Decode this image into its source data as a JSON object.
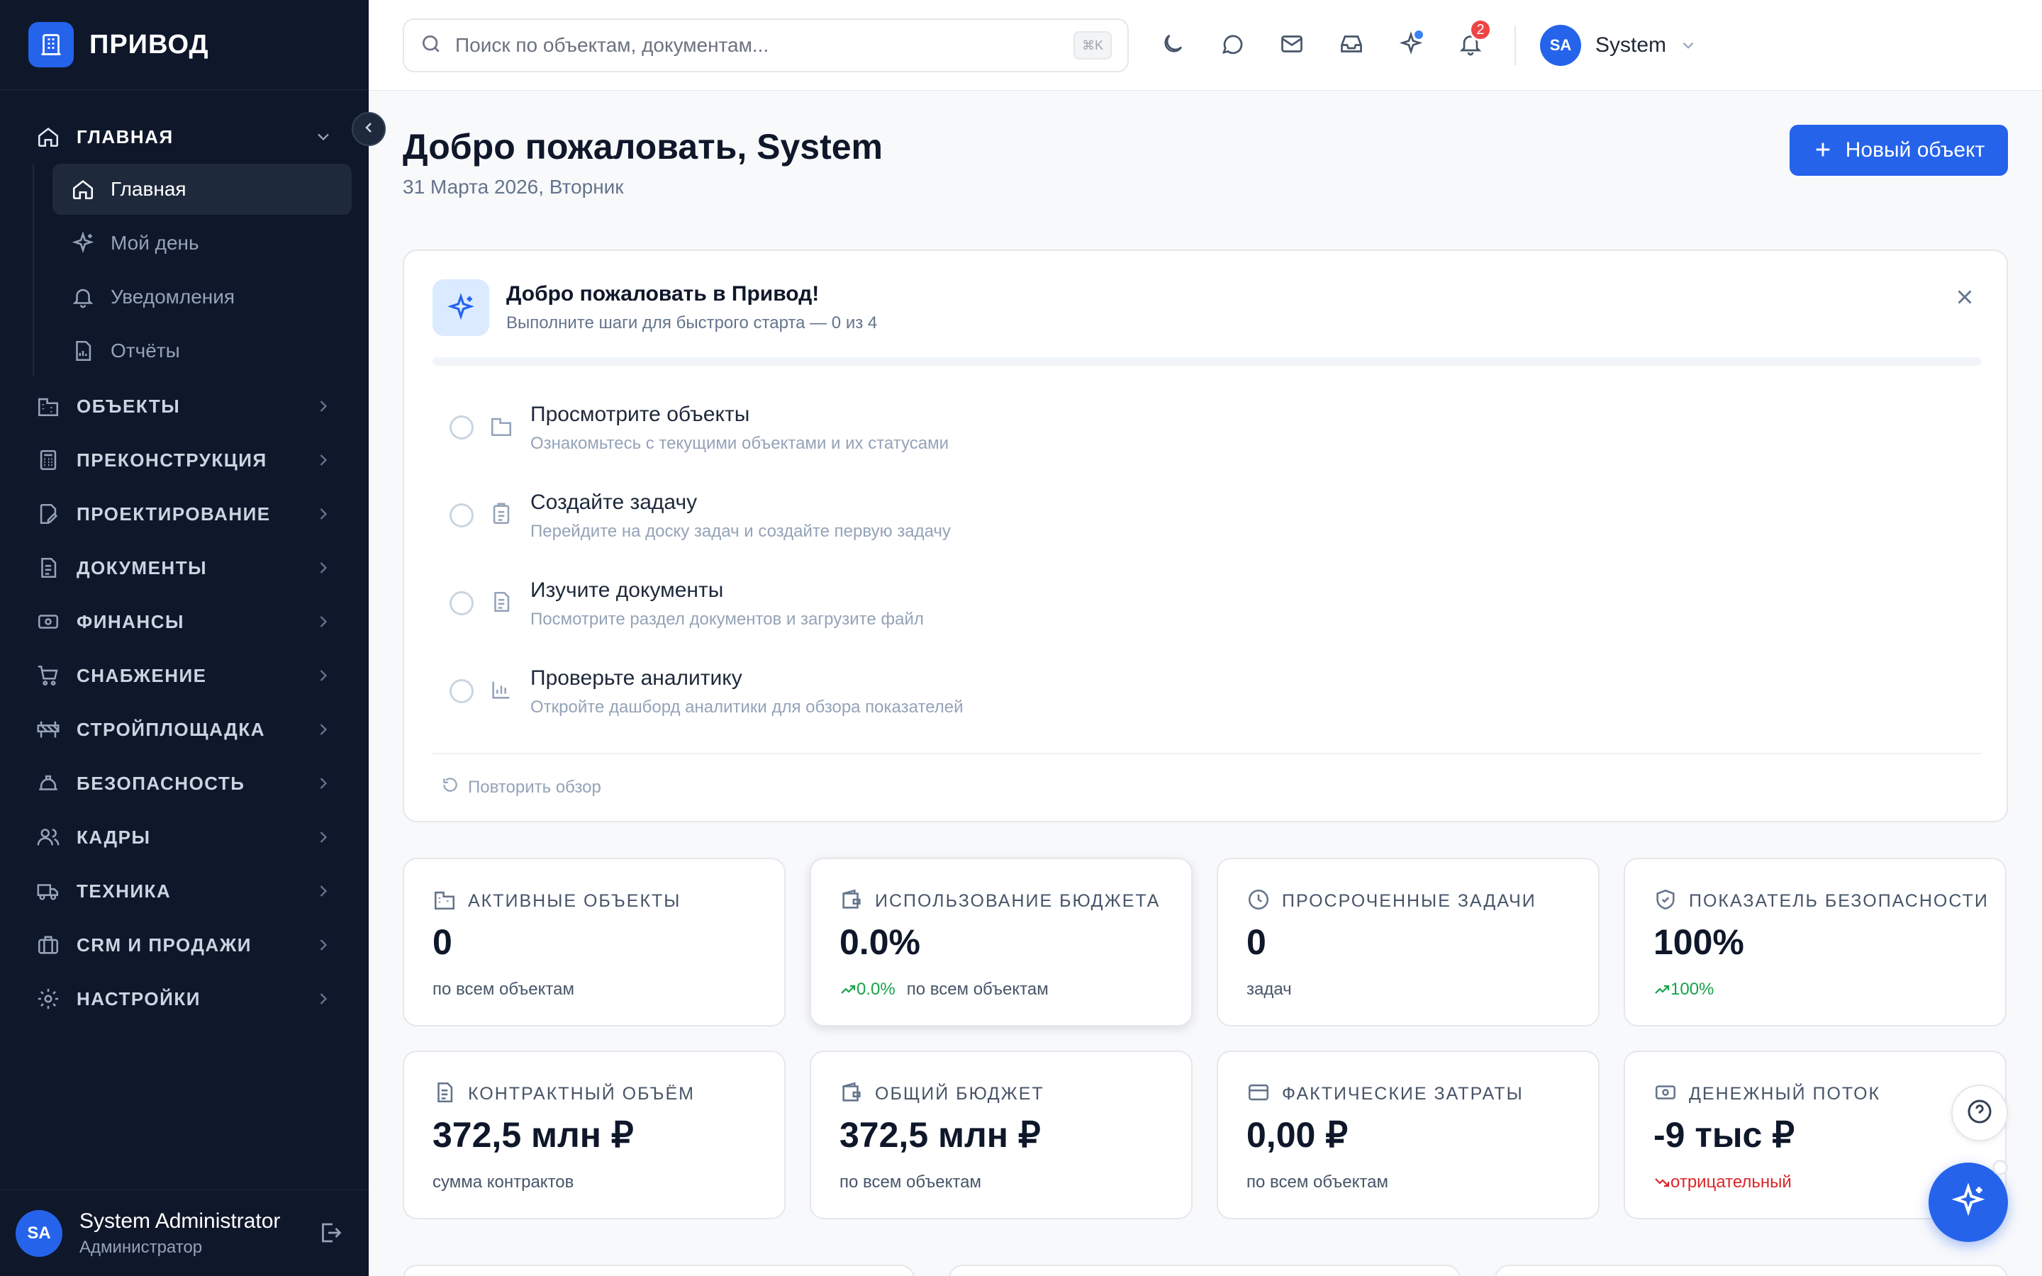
{
  "app": {
    "name": "ПРИВОД"
  },
  "sidebar": {
    "main_section": {
      "label": "ГЛАВНАЯ"
    },
    "sub_items": [
      {
        "label": "Главная",
        "icon": "home-icon",
        "active": true
      },
      {
        "label": "Мой день",
        "icon": "sparkles-icon"
      },
      {
        "label": "Уведомления",
        "icon": "bell-icon"
      },
      {
        "label": "Отчёты",
        "icon": "report-icon"
      }
    ],
    "sections": [
      {
        "label": "ОБЪЕКТЫ",
        "icon": "building-icon"
      },
      {
        "label": "ПРЕКОНСТРУКЦИЯ",
        "icon": "calculator-icon"
      },
      {
        "label": "ПРОЕКТИРОВАНИЕ",
        "icon": "design-icon"
      },
      {
        "label": "ДОКУМЕНТЫ",
        "icon": "document-icon"
      },
      {
        "label": "ФИНАНСЫ",
        "icon": "money-icon"
      },
      {
        "label": "СНАБЖЕНИЕ",
        "icon": "cart-icon"
      },
      {
        "label": "СТРОЙПЛОЩАДКА",
        "icon": "barrier-icon"
      },
      {
        "label": "БЕЗОПАСНОСТЬ",
        "icon": "hardhat-icon"
      },
      {
        "label": "КАДРЫ",
        "icon": "users-icon"
      },
      {
        "label": "ТЕХНИКА",
        "icon": "truck-icon"
      },
      {
        "label": "CRM И ПРОДАЖИ",
        "icon": "briefcase-icon"
      },
      {
        "label": "НАСТРОЙКИ",
        "icon": "gear-icon"
      }
    ],
    "user": {
      "initials": "SA",
      "name": "System Administrator",
      "role": "Администратор"
    }
  },
  "topbar": {
    "search": {
      "placeholder": "Поиск по объектам, документам...",
      "shortcut": "⌘K"
    },
    "notifications_count": "2",
    "user": {
      "initials": "SA",
      "name": "System"
    }
  },
  "page": {
    "title": "Добро пожаловать, System",
    "date": "31 Марта 2026, Вторник",
    "new_button": "Новый объект"
  },
  "welcome": {
    "title": "Добро пожаловать в Привод!",
    "subtitle": "Выполните шаги для быстрого старта — 0 из 4",
    "progress": 0,
    "steps": [
      {
        "title": "Просмотрите объекты",
        "desc": "Ознакомьтесь с текущими объектами и их статусами",
        "icon": "building-icon"
      },
      {
        "title": "Создайте задачу",
        "desc": "Перейдите на доску задач и создайте первую задачу",
        "icon": "clipboard-icon"
      },
      {
        "title": "Изучите документы",
        "desc": "Посмотрите раздел документов и загрузите файл",
        "icon": "document-icon"
      },
      {
        "title": "Проверьте аналитику",
        "desc": "Откройте дашборд аналитики для обзора показателей",
        "icon": "chart-icon"
      }
    ],
    "replay": "Повторить обзор"
  },
  "kpis": [
    {
      "label": "АКТИВНЫЕ ОБЪЕКТЫ",
      "value": "0",
      "trend": "",
      "foot": "по всем объектам",
      "icon": "building-icon"
    },
    {
      "label": "ИСПОЛЬЗОВАНИЕ БЮДЖЕТА",
      "value": "0.0%",
      "trend": "0.0%",
      "foot": "по всем объектам",
      "icon": "wallet-icon"
    },
    {
      "label": "ПРОСРОЧЕННЫЕ ЗАДАЧИ",
      "value": "0",
      "trend": "",
      "foot": "задач",
      "icon": "clock-icon"
    },
    {
      "label": "ПОКАЗАТЕЛЬ БЕЗОПАСНОСТИ",
      "value": "100%",
      "trend": "100%",
      "foot": "",
      "icon": "shield-icon"
    },
    {
      "label": "КОНТРАКТНЫЙ ОБЪЁМ",
      "value": "372,5 млн ₽",
      "trend": "",
      "foot": "сумма контрактов",
      "icon": "document-icon"
    },
    {
      "label": "ОБЩИЙ БЮДЖЕТ",
      "value": "372,5 млн ₽",
      "trend": "",
      "foot": "по всем объектам",
      "icon": "wallet-icon"
    },
    {
      "label": "ФАКТИЧЕСКИЕ ЗАТРАТЫ",
      "value": "0,00 ₽",
      "trend": "",
      "foot": "по всем объектам",
      "icon": "card-icon"
    },
    {
      "label": "ДЕНЕЖНЫЙ ПОТОК",
      "value": "-9 тыс ₽",
      "trend": "отрицательный",
      "foot": "",
      "icon": "cash-icon"
    }
  ]
}
